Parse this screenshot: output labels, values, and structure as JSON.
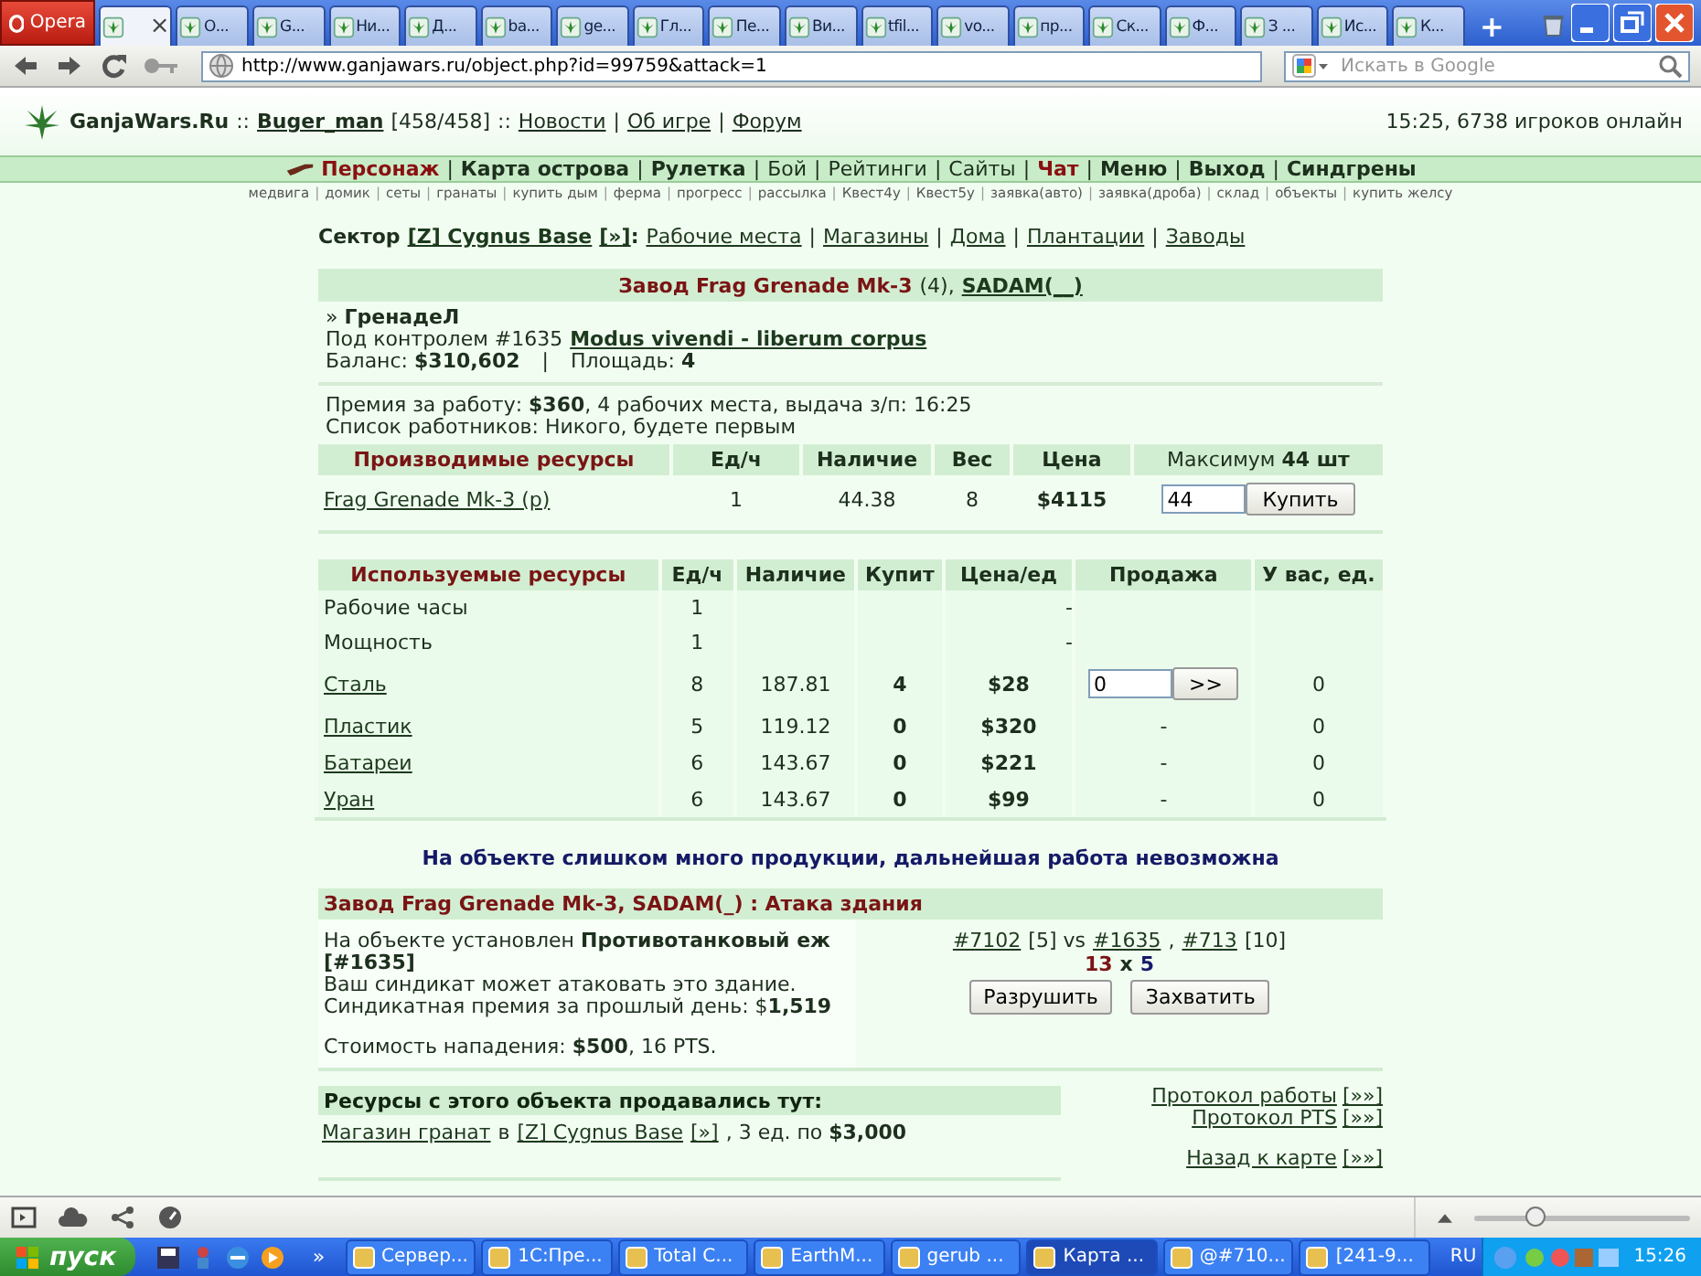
{
  "browser": {
    "opera": "Opera",
    "tabs": [
      {
        "close": "×",
        "selected": true
      },
      {
        "label": "О...",
        "selected": false
      },
      {
        "label": "G...",
        "selected": false
      },
      {
        "label": "Ни...",
        "selected": false
      },
      {
        "label": "Д...",
        "selected": false
      },
      {
        "label": "ba...",
        "selected": false
      },
      {
        "label": "ge...",
        "selected": false
      },
      {
        "label": "Гл...",
        "selected": false
      },
      {
        "label": "Пе...",
        "selected": false
      },
      {
        "label": "Ви...",
        "selected": false
      },
      {
        "label": "tfil...",
        "selected": false
      },
      {
        "label": "vo...",
        "selected": false
      },
      {
        "label": "пр...",
        "selected": false
      },
      {
        "label": "Ск...",
        "selected": false
      },
      {
        "label": "Ф...",
        "selected": false
      },
      {
        "label": "З ...",
        "selected": false
      },
      {
        "label": "Ис...",
        "selected": false
      },
      {
        "label": "К...",
        "selected": false
      }
    ],
    "new_tab": "+",
    "url": "http://www.ganjawars.ru/object.php?id=99759&attack=1",
    "search_placeholder": "Искать в Google"
  },
  "header": {
    "site": "GanjaWars.Ru",
    "sep1": "::",
    "user": "Buger_man",
    "hp": "[458/458]",
    "sep2": "::",
    "links": [
      {
        "label": "Новости",
        "sep": "|"
      },
      {
        "label": "Об игре",
        "sep": "|"
      },
      {
        "label": "Форум"
      }
    ],
    "status": "15:25, 6738 игроков онлайн"
  },
  "nav": [
    {
      "label": "Персонаж",
      "kind": "accent",
      "sep": "|"
    },
    {
      "label": "Карта острова",
      "kind": "strong",
      "sep": "|"
    },
    {
      "label": "Рулетка",
      "kind": "strong",
      "sep": "|"
    },
    {
      "label": "Бой",
      "kind": "plain",
      "sep": "|"
    },
    {
      "label": "Рейтинги",
      "kind": "plain",
      "sep": "|"
    },
    {
      "label": "Сайты",
      "kind": "plain",
      "sep": "|"
    },
    {
      "label": "Чат",
      "kind": "accent",
      "sep": "|"
    },
    {
      "label": "Меню",
      "kind": "strong",
      "sep": "|"
    },
    {
      "label": "Выход",
      "kind": "strong",
      "sep": "|"
    },
    {
      "label": "Синдгрены",
      "kind": "strong"
    }
  ],
  "subnav": [
    {
      "label": "медвига",
      "sep": "|"
    },
    {
      "label": "домик",
      "sep": "|"
    },
    {
      "label": "сеты",
      "sep": "|"
    },
    {
      "label": "гранаты",
      "sep": "|"
    },
    {
      "label": "купить дым",
      "sep": "|"
    },
    {
      "label": "ферма",
      "sep": "|"
    },
    {
      "label": "прогресс",
      "sep": "|"
    },
    {
      "label": "рассылка",
      "sep": "|"
    },
    {
      "label": "Квест4у",
      "sep": "|"
    },
    {
      "label": "Квест5у",
      "sep": "|"
    },
    {
      "label": "заявка(авто)",
      "sep": "|"
    },
    {
      "label": "заявка(дроба)",
      "sep": "|"
    },
    {
      "label": "склад",
      "sep": "|"
    },
    {
      "label": "объекты",
      "sep": "|"
    },
    {
      "label": "купить желсу"
    }
  ],
  "sector": {
    "label": "Сектор",
    "name": "[Z] Cygnus Base",
    "more": "[»]",
    "colon": ":",
    "links": [
      {
        "label": "Рабочие места",
        "sep": "|"
      },
      {
        "label": "Магазины",
        "sep": "|"
      },
      {
        "label": "Дома",
        "sep": "|"
      },
      {
        "label": "Плантации",
        "sep": "|"
      },
      {
        "label": "Заводы"
      }
    ]
  },
  "factory": {
    "title": "Завод Frag Grenade Mk-3",
    "grade": "(4),",
    "owner": "SADAM(__)",
    "name": "» **ГренадеЛ**",
    "control": {
      "text": "Под контролем #1635",
      "link": "Modus vivendi - liberum corpus"
    },
    "balance": "Баланс: **$310,602**",
    "balance_sep": "|",
    "area": "Площадь: **4**",
    "premium": "Премия за работу: **$360**, 4 рабочих места, выдача з/п: 16:25",
    "workers": "Список работников: Никого, будете первым"
  },
  "produced": {
    "columns": [
      "Производимые ресурсы",
      "Ед/ч",
      "Наличие",
      "Вес",
      "Цена"
    ],
    "max": "Максимум **44 шт**",
    "rows": [
      {
        "name": "Frag Grenade Mk-3 (p)",
        "per_hour": "1",
        "stock": "44.38",
        "weight": "8",
        "price": "$4115",
        "amount": "44",
        "button": "Купить"
      }
    ]
  },
  "used": {
    "columns": [
      "Используемые ресурсы",
      "Ед/ч",
      "Наличие",
      "Купит",
      "Цена/ед",
      "Продажа",
      "У вас, ед."
    ],
    "rows": [
      {
        "kind": "plain",
        "name": "Рабочие часы",
        "per_hour": "1",
        "price": "-"
      },
      {
        "kind": "plain",
        "name": "Мощность",
        "per_hour": "1",
        "price": "-"
      },
      {
        "kind": "link",
        "name": "Сталь",
        "per_hour": "8",
        "stock": "187.81",
        "buy": "4",
        "price": "$28",
        "sale": {
          "kind": "input",
          "value": "0",
          "button": ">>"
        },
        "have": "0"
      },
      {
        "kind": "link",
        "name": "Пластик",
        "per_hour": "5",
        "stock": "119.12",
        "buy": "0",
        "price": "$320",
        "sale": {
          "kind": "text",
          "text": "-"
        },
        "have": "0"
      },
      {
        "kind": "link",
        "name": "Батареи",
        "per_hour": "6",
        "stock": "143.67",
        "buy": "0",
        "price": "$221",
        "sale": {
          "kind": "text",
          "text": "-"
        },
        "have": "0"
      },
      {
        "kind": "link",
        "name": "Уран",
        "per_hour": "6",
        "stock": "143.67",
        "buy": "0",
        "price": "$99",
        "sale": {
          "kind": "text",
          "text": "-"
        },
        "have": "0"
      }
    ]
  },
  "warning": "На объекте слишком много продукции, дальнейшая работа невозможна",
  "attack": {
    "title": "Завод Frag Grenade Mk-3, SADAM(_) : Атака здания",
    "lines": [
      "На объекте установлен **Противотанковый еж [#1635]**",
      "Ваш синдикат может атаковать это здание.",
      "Синдикатная премия за прошлый день: $**1,519**"
    ],
    "cost": "Стоимость нападения: **$500**, 16 PTS.",
    "sides": [
      {
        "kind": "link",
        "text": "#7102"
      },
      {
        "kind": "text",
        "text": "[5] vs"
      },
      {
        "kind": "link",
        "text": "#1635"
      },
      {
        "kind": "text",
        "text": ","
      },
      {
        "kind": "link",
        "text": "#713"
      },
      {
        "kind": "text",
        "text": "[10]"
      }
    ],
    "score": {
      "ours": "13",
      "x": "x",
      "theirs": "5"
    },
    "buttons": [
      "Разрушить",
      "Захватить"
    ]
  },
  "sold": {
    "title": "Ресурсы с этого объекта продавались тут:",
    "parts": [
      {
        "kind": "link",
        "text": "Магазин гранат"
      },
      {
        "kind": "text",
        "text": "в"
      },
      {
        "kind": "link",
        "text": "[Z] Cygnus Base"
      },
      {
        "kind": "link",
        "text": "[»]"
      },
      {
        "kind": "text",
        "text": ", 3 ед. по **$3,000**"
      }
    ]
  },
  "side_links": [
    {
      "label": "Протокол работы",
      "more": "[»»]"
    },
    {
      "label": "Протокол PTS",
      "more": "[»»]"
    },
    {
      "label": "Назад к карте",
      "more": "[»»]"
    }
  ],
  "zoom": {
    "level": 0.28
  },
  "taskbar": {
    "start": "пуск",
    "more": "»",
    "tasks": [
      {
        "label": "Сервер...",
        "selected": false
      },
      {
        "label": "1С:Пре...",
        "selected": false
      },
      {
        "label": "Total C...",
        "selected": false
      },
      {
        "label": "EarthM...",
        "selected": false
      },
      {
        "label": "gerub ...",
        "selected": false
      },
      {
        "label": "Карта ...",
        "selected": true
      },
      {
        "label": "@#710...",
        "selected": false
      },
      {
        "label": "[241-9...",
        "selected": false
      }
    ],
    "lang": "RU",
    "clock": "15:26"
  }
}
